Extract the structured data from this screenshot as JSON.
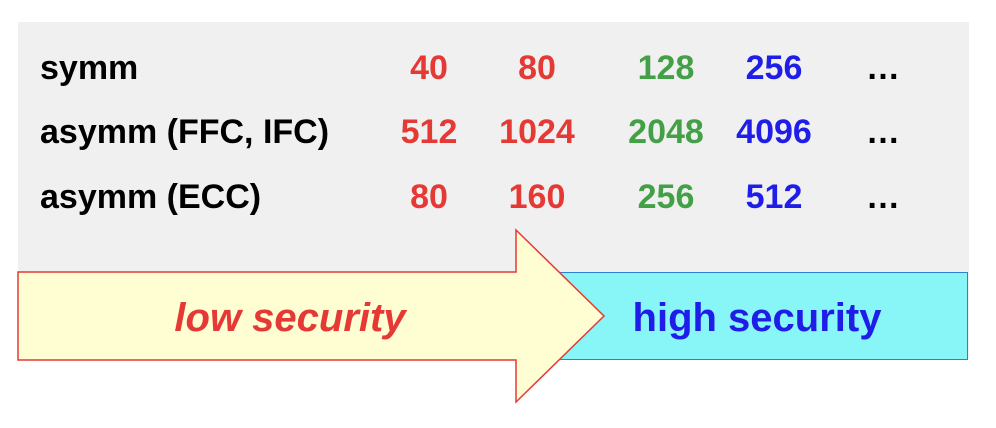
{
  "rows": [
    {
      "label": "symm",
      "values": [
        "40",
        "80",
        "128",
        "256",
        "…"
      ]
    },
    {
      "label": "asymm (FFC, IFC)",
      "values": [
        "512",
        "1024",
        "2048",
        "4096",
        "…"
      ]
    },
    {
      "label": "asymm (ECC)",
      "values": [
        "80",
        "160",
        "256",
        "512",
        "…"
      ]
    }
  ],
  "column_colors": [
    "#e53935",
    "#e53935",
    "#43a047",
    "#1e1ee8",
    "#000000"
  ],
  "arrow": {
    "low_label": "low security",
    "high_label": "high security",
    "low_fill": "#fffdd2",
    "high_fill": "#88f5f7",
    "low_color": "#e53935",
    "high_color": "#1e1ee8"
  }
}
